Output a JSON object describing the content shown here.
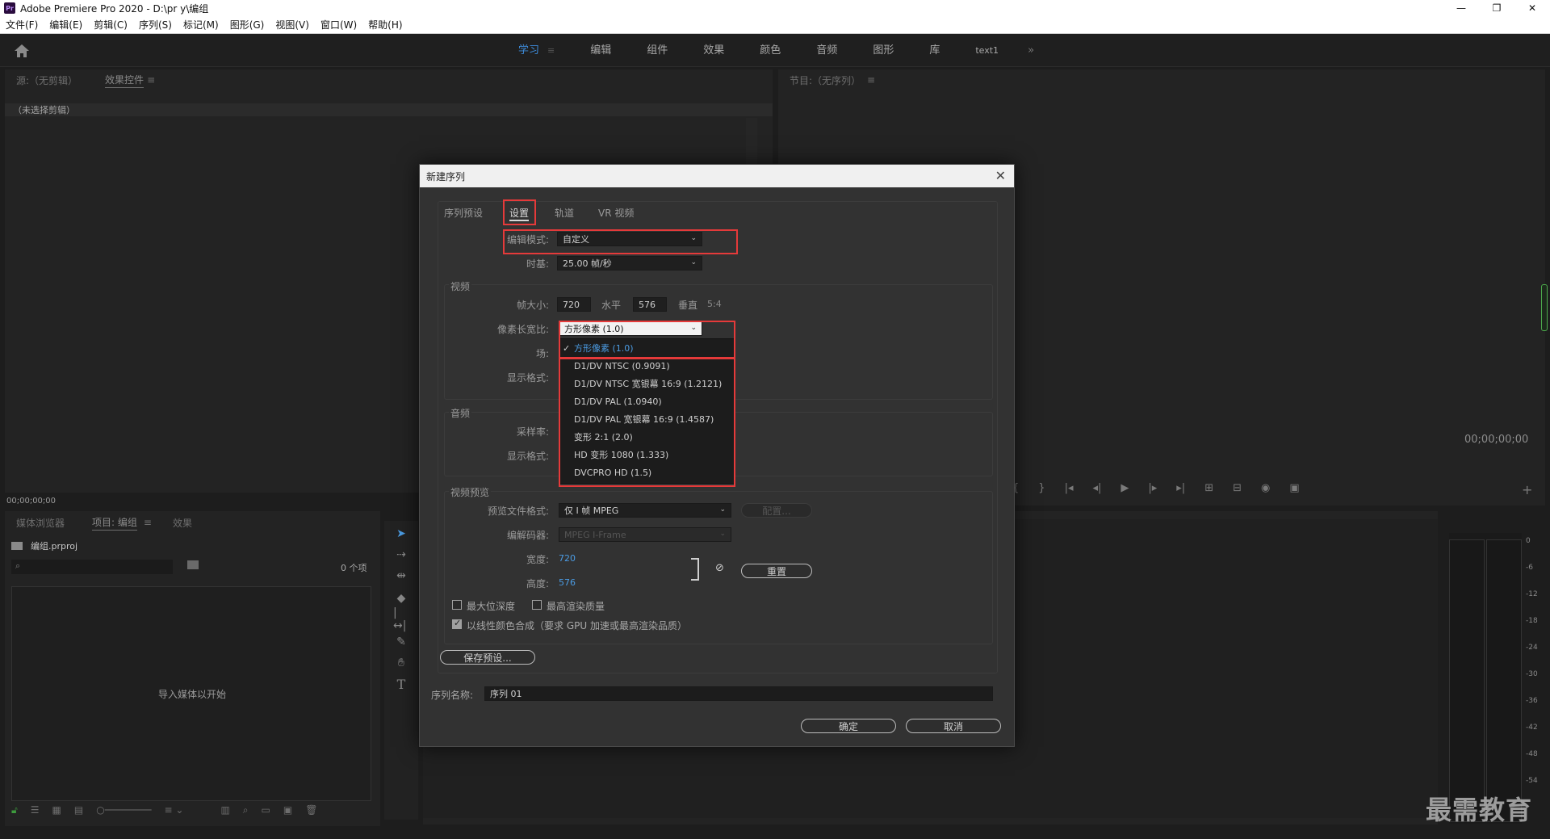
{
  "app": {
    "title": "Adobe Premiere Pro 2020 - D:\\pr y\\编组",
    "icon_label": "Pr",
    "window_controls": [
      "—",
      "❐",
      "✕"
    ]
  },
  "menu": [
    "文件(F)",
    "编辑(E)",
    "剪辑(C)",
    "序列(S)",
    "标记(M)",
    "图形(G)",
    "视图(V)",
    "窗口(W)",
    "帮助(H)"
  ],
  "workspace": {
    "tabs": [
      "学习",
      "编辑",
      "组件",
      "效果",
      "颜色",
      "音频",
      "图形",
      "库",
      "text1"
    ],
    "active": "学习",
    "more": "»"
  },
  "source_panel": {
    "tabs": [
      "源:（无剪辑）",
      "效果控件"
    ],
    "no_selection": "（未选择剪辑）",
    "timecode": "00;00;00;00"
  },
  "program_panel": {
    "title": "节目:（无序列）",
    "timecode": "00;00;00;00"
  },
  "project_panel": {
    "tabs": [
      "媒体浏览器",
      "项目: 编组",
      "效果"
    ],
    "project_file": "编组.prproj",
    "item_count": "0 个项",
    "import_hint": "导入媒体以开始"
  },
  "meter_scale": [
    "0",
    "-6",
    "-12",
    "-18",
    "-24",
    "-30",
    "-36",
    "-42",
    "-48",
    "-54"
  ],
  "dialog": {
    "title": "新建序列",
    "tabs": [
      "序列预设",
      "设置",
      "轨道",
      "VR 视频"
    ],
    "edit_mode_label": "编辑模式:",
    "edit_mode_value": "自定义",
    "timebase_label": "时基:",
    "timebase_value": "25.00  帧/秒",
    "video_section": "视频",
    "frame_size_label": "帧大小:",
    "frame_width": "720",
    "horizontal_label": "水平",
    "frame_height": "576",
    "vertical_label": "垂直",
    "aspect": "5:4",
    "pixel_aspect_label": "像素长宽比:",
    "pixel_aspect_value": "方形像素 (1.0)",
    "field_label": "场:",
    "display_format_label": "显示格式:",
    "pixel_aspect_options": [
      "方形像素 (1.0)",
      "D1/DV NTSC (0.9091)",
      "D1/DV NTSC 宽银幕 16:9 (1.2121)",
      "D1/DV PAL (1.0940)",
      "D1/DV PAL 宽银幕 16:9 (1.4587)",
      "变形 2:1 (2.0)",
      "HD 变形 1080 (1.333)",
      "DVCPRO HD (1.5)"
    ],
    "audio_section": "音频",
    "sample_rate_label": "采样率:",
    "audio_display_format_label": "显示格式:",
    "preview_section": "视频预览",
    "preview_format_label": "预览文件格式:",
    "preview_format_value": "仅 I 帧 MPEG",
    "config_button": "配置...",
    "codec_label": "编解码器:",
    "codec_value": "MPEG I-Frame",
    "width_label": "宽度:",
    "width_value": "720",
    "height_label": "高度:",
    "height_value": "576",
    "reset_button": "重置",
    "max_bit_depth": "最大位深度",
    "max_render_quality": "最高渲染质量",
    "linear_color": "以线性颜色合成（要求 GPU 加速或最高渲染品质）",
    "save_preset": "保存预设...",
    "sequence_name_label": "序列名称:",
    "sequence_name_value": "序列 01",
    "ok": "确定",
    "cancel": "取消"
  },
  "watermark": "最需教育",
  "colors": {
    "accent": "#3d8bd9",
    "highlight_box": "#e53a3a"
  }
}
